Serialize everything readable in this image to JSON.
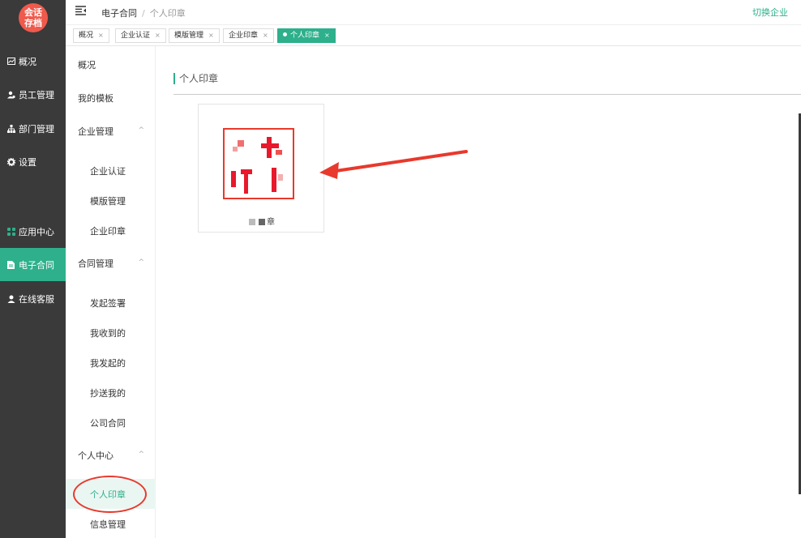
{
  "logo": {
    "line1": "会话",
    "line2": "存档"
  },
  "sidebar": {
    "items": [
      {
        "label": "概况",
        "icon": "chart-icon"
      },
      {
        "label": "员工管理",
        "icon": "users-icon"
      },
      {
        "label": "部门管理",
        "icon": "org-icon"
      },
      {
        "label": "设置",
        "icon": "gear-icon"
      },
      {
        "label": "应用中心",
        "icon": "apps-icon"
      },
      {
        "label": "电子合同",
        "icon": "document-icon"
      },
      {
        "label": "在线客服",
        "icon": "person-icon"
      }
    ]
  },
  "header": {
    "breadcrumb_parent": "电子合同",
    "breadcrumb_sep": "/",
    "breadcrumb_current": "个人印章",
    "switch_label": "切换企业"
  },
  "tabs": [
    {
      "label": "概况",
      "close": "×"
    },
    {
      "label": "企业认证",
      "close": "×"
    },
    {
      "label": "模版管理",
      "close": "×"
    },
    {
      "label": "企业印章",
      "close": "×"
    },
    {
      "label": "个人印章",
      "close": "×"
    }
  ],
  "subnav": {
    "items": [
      {
        "label": "概况"
      },
      {
        "label": "我的模板"
      },
      {
        "label": "企业管理",
        "chev": "^"
      },
      {
        "label": "企业认证"
      },
      {
        "label": "模版管理"
      },
      {
        "label": "企业印章"
      },
      {
        "label": "合同管理",
        "chev": "^"
      },
      {
        "label": "发起签署"
      },
      {
        "label": "我收到的"
      },
      {
        "label": "我发起的"
      },
      {
        "label": "抄送我的"
      },
      {
        "label": "公司合同"
      },
      {
        "label": "个人中心",
        "chev": "^"
      },
      {
        "label": "个人印章"
      },
      {
        "label": "信息管理"
      }
    ]
  },
  "main": {
    "section_title": "个人印章",
    "seal": {
      "name": "章"
    }
  },
  "colors": {
    "accent": "#2db08b",
    "sidebar": "#3a3a3a",
    "annotation": "#e8392c"
  }
}
